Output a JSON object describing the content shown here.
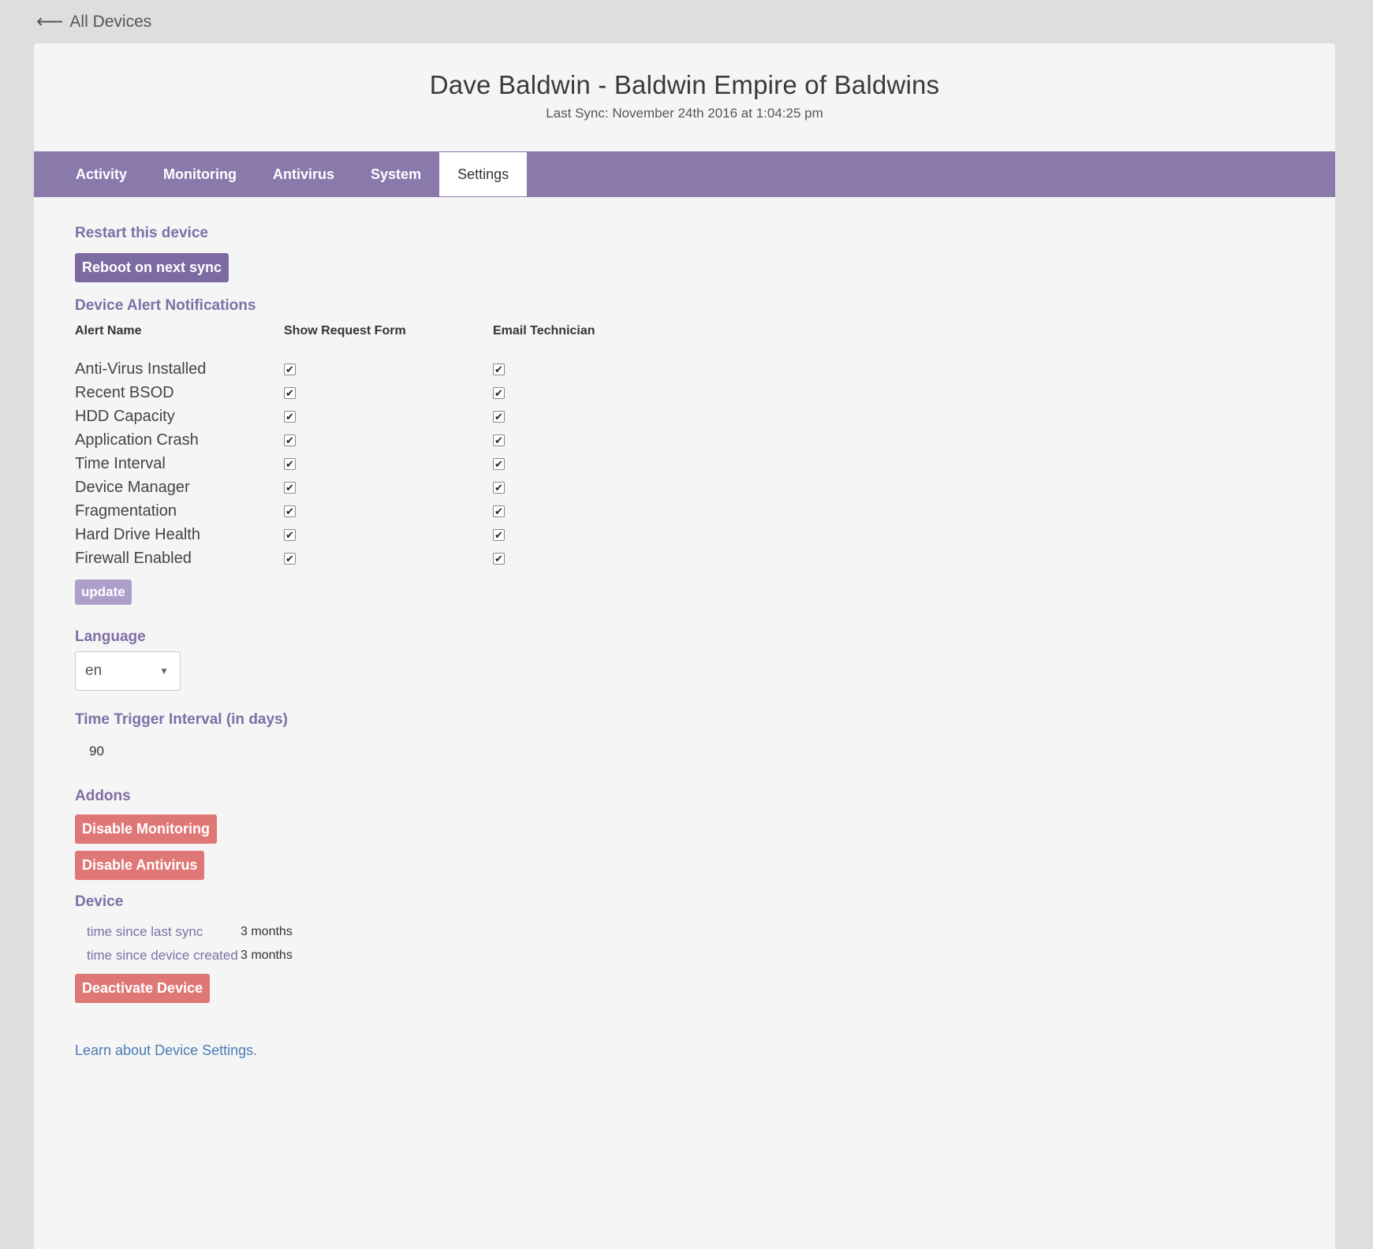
{
  "nav": {
    "back_icon": "arrow-left-icon",
    "back_label": "All Devices"
  },
  "header": {
    "title": "Dave Baldwin - Baldwin Empire of Baldwins",
    "last_sync": "Last Sync: November 24th 2016 at 1:04:25 pm"
  },
  "tabs": [
    {
      "label": "Activity"
    },
    {
      "label": "Monitoring"
    },
    {
      "label": "Antivirus"
    },
    {
      "label": "System"
    },
    {
      "label": "Settings",
      "active": true
    }
  ],
  "restart": {
    "title": "Restart this device",
    "button": "Reboot on next sync"
  },
  "alerts": {
    "title": "Device Alert Notifications",
    "columns": [
      "Alert Name",
      "Show Request Form",
      "Email Technician"
    ],
    "rows": [
      {
        "name": "Anti-Virus Installed",
        "show_form": true,
        "email": true
      },
      {
        "name": "Recent BSOD",
        "show_form": true,
        "email": true
      },
      {
        "name": "HDD Capacity",
        "show_form": true,
        "email": true
      },
      {
        "name": "Application Crash",
        "show_form": true,
        "email": true
      },
      {
        "name": "Time Interval",
        "show_form": true,
        "email": true
      },
      {
        "name": "Device Manager",
        "show_form": true,
        "email": true
      },
      {
        "name": "Fragmentation",
        "show_form": true,
        "email": true
      },
      {
        "name": "Hard Drive Health",
        "show_form": true,
        "email": true
      },
      {
        "name": "Firewall Enabled",
        "show_form": true,
        "email": true
      }
    ],
    "update_button": "update"
  },
  "language": {
    "title": "Language",
    "value": "en"
  },
  "time_trigger": {
    "title": "Time Trigger Interval (in days)",
    "value": "90"
  },
  "addons": {
    "title": "Addons",
    "disable_monitoring": "Disable Monitoring",
    "disable_antivirus": "Disable Antivirus"
  },
  "device": {
    "title": "Device",
    "rows": [
      {
        "key": "time since last sync",
        "value": "3 months"
      },
      {
        "key": "time since device created",
        "value": "3 months"
      }
    ],
    "deactivate_button": "Deactivate Device"
  },
  "learn_link": "Learn about Device Settings.",
  "colors": {
    "accent_purple": "#8a79ab",
    "button_purple": "#7c6aa3",
    "danger": "#e07777",
    "link": "#4a7bb5"
  }
}
